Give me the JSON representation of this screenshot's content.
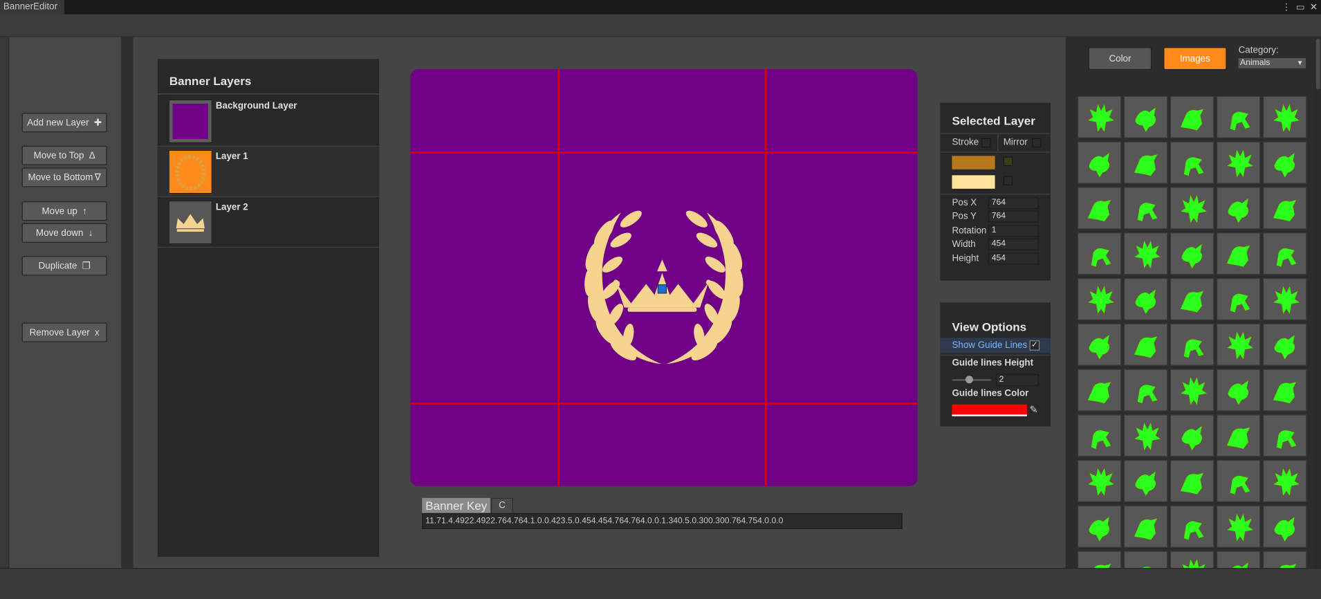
{
  "window": {
    "tab_title": "BannerEditor",
    "menu_icon": "kebab-menu-icon",
    "maximize_icon": "maximize-icon",
    "close_icon": "close-icon"
  },
  "left_toolbar": {
    "add_layer": {
      "label": "Add new Layer",
      "icon": "✚"
    },
    "move_top": {
      "label": "Move to Top",
      "icon": "Δ"
    },
    "move_bottom": {
      "label": "Move to Bottom",
      "icon": "∇"
    },
    "move_up": {
      "label": "Move up",
      "icon": "↑"
    },
    "move_down": {
      "label": "Move down",
      "icon": "↓"
    },
    "duplicate": {
      "label": "Duplicate",
      "icon": "❐"
    },
    "remove": {
      "label": "Remove Layer",
      "icon": "x"
    }
  },
  "layers_panel": {
    "title": "Banner Layers",
    "layers": [
      {
        "name": "Background Layer",
        "thumb_color": "#700086",
        "selected": false
      },
      {
        "name": "Layer 1",
        "thumb_color": "#ff8a1c",
        "selected": true
      },
      {
        "name": "Layer 2",
        "thumb_color": "#575757",
        "selected": false
      }
    ]
  },
  "canvas": {
    "background_color": "#700086",
    "guide_color": "#e00000",
    "emblem_color": "#f5d490"
  },
  "banner_key": {
    "label": "Banner Key",
    "copy_label": "C",
    "value": "11.71.4.4922.4922.764.764.1.0.0.423.5.0.454.454.764.764.0.0.1.340.5.0.300.300.764.754.0.0.0"
  },
  "selected_layer": {
    "title": "Selected Layer",
    "stroke_label": "Stroke",
    "mirror_label": "Mirror",
    "primary_color": "#b8791c",
    "secondary_color": "#fde49a",
    "properties": [
      {
        "label": "Pos X",
        "value": "764"
      },
      {
        "label": "Pos Y",
        "value": "764"
      },
      {
        "label": "Rotation",
        "value": "1"
      },
      {
        "label": "Width",
        "value": "454"
      },
      {
        "label": "Height",
        "value": "454"
      }
    ]
  },
  "view_options": {
    "title": "View Options",
    "show_guides_label": "Show Guide Lines",
    "show_guides_checked": true,
    "height_label": "Guide lines Height",
    "height_value": "2",
    "height_slider_fraction": 0.45,
    "color_label": "Guide lines Color",
    "guide_color": "#ff0000",
    "picker_icon": "eyedropper-icon"
  },
  "asset_browser": {
    "color_tab": "Color",
    "images_tab": "Images",
    "active_tab": "Images",
    "category_label": "Category:",
    "category_value": "Animals",
    "icon_color": "#2cff1c",
    "icons": [
      "eagle-icon",
      "eagle-icon",
      "eagle-icon",
      "eagle-icon",
      "eagle-icon",
      "eagle-icon",
      "eagle-icon",
      "eagle-icon",
      "bird-icon",
      "bird-icon",
      "bird-icon",
      "bird-icon",
      "bird-icon",
      "bird-icon",
      "bird-icon",
      "bird-icon",
      "bird-icon",
      "bird-icon",
      "bird-icon",
      "bird-icon",
      "griffin-icon",
      "beast-icon",
      "seahorse-icon",
      "lion-head-icon",
      "horse-icon",
      "horse-icon",
      "horse-icon",
      "horse-icon",
      "archer-icon",
      "horseman-icon",
      "beast-icon",
      "dragon-head-icon",
      "ram-icon",
      "stag-head-icon",
      "bull-head-icon",
      "deer-icon",
      "deer-icon",
      "giraffe-icon",
      "bear-icon",
      "lion-head-icon",
      "lion-icon",
      "lion-icon",
      "lion-icon",
      "lion-icon",
      "lion-icon",
      "lion-icon",
      "lion-icon",
      "lion-head-icon",
      "fox-icon",
      "lion-icon",
      "beast-icon",
      "beast-icon",
      "beast-icon",
      "beast-icon",
      "beast-icon"
    ]
  }
}
